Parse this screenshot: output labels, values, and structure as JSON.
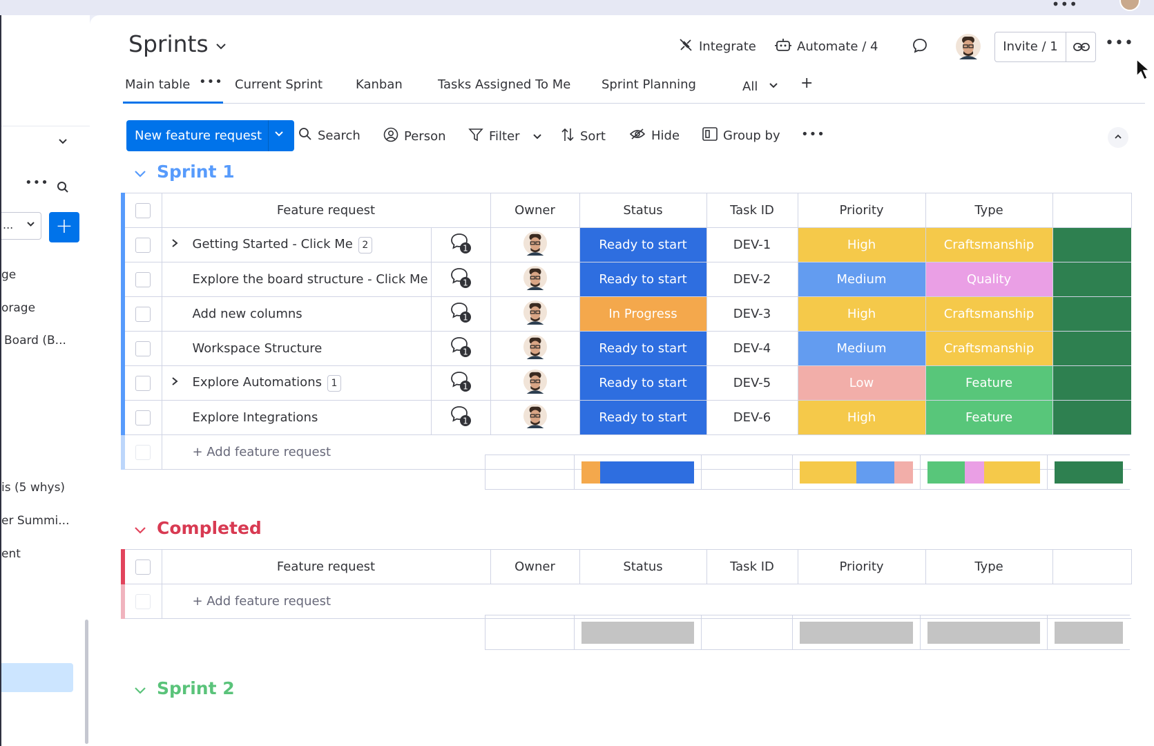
{
  "sidebar": {
    "workspace_label": "...",
    "items": [
      {
        "label": "ge"
      },
      {
        "label": "orage"
      },
      {
        "label": "Board (B..."
      },
      {
        "label": "is (5 whys)"
      },
      {
        "label": "er Summi..."
      },
      {
        "label": "ent"
      }
    ]
  },
  "header": {
    "title": "Sprints",
    "integrate": "Integrate",
    "automate": "Automate / 4",
    "invite": "Invite / 1"
  },
  "tabs": [
    {
      "label": "Main table"
    },
    {
      "label": "Current Sprint"
    },
    {
      "label": "Kanban"
    },
    {
      "label": "Tasks Assigned To Me"
    },
    {
      "label": "Sprint Planning"
    }
  ],
  "tabs_extra": {
    "all": "All"
  },
  "toolbar": {
    "new_item": "New feature request",
    "search": "Search",
    "person": "Person",
    "filter": "Filter",
    "sort": "Sort",
    "hide": "Hide",
    "group_by": "Group by"
  },
  "columns": {
    "name": "Feature request",
    "owner": "Owner",
    "status": "Status",
    "task_id": "Task ID",
    "priority": "Priority",
    "type": "Type"
  },
  "colors": {
    "primary": "#0073ea",
    "ready": "#2e6ee0",
    "in_progress": "#f4a84c",
    "high": "#f5c94a",
    "medium": "#639cf0",
    "low": "#f2aea9",
    "craftsmanship": "#f5c94a",
    "quality": "#ea9fe5",
    "feature": "#58c67a",
    "dark_green": "#2e8050",
    "sprint1": "#579bfc",
    "completed": "#e2445c",
    "sprint2": "#5ac37a",
    "empty_bar": "#c4c4c4"
  },
  "groups": [
    {
      "title": "Sprint 1",
      "add_label": "+ Add feature request",
      "rows": [
        {
          "name": "Getting Started - Click Me",
          "subitems": "2",
          "updates": "1",
          "status": "Ready to start",
          "task_id": "DEV-1",
          "priority": "High",
          "type": "Craftsmanship"
        },
        {
          "name": "Explore the board structure - Click Me",
          "updates": "1",
          "status": "Ready to start",
          "task_id": "DEV-2",
          "priority": "Medium",
          "type": "Quality"
        },
        {
          "name": "Add new columns",
          "updates": "1",
          "status": "In Progress",
          "task_id": "DEV-3",
          "priority": "High",
          "type": "Craftsmanship"
        },
        {
          "name": "Workspace Structure",
          "updates": "1",
          "status": "Ready to start",
          "task_id": "DEV-4",
          "priority": "Medium",
          "type": "Craftsmanship"
        },
        {
          "name": "Explore Automations",
          "subitems": "1",
          "updates": "1",
          "status": "Ready to start",
          "task_id": "DEV-5",
          "priority": "Low",
          "type": "Feature"
        },
        {
          "name": "Explore Integrations",
          "updates": "1",
          "status": "Ready to start",
          "task_id": "DEV-6",
          "priority": "High",
          "type": "Feature"
        }
      ],
      "summary": {
        "status": [
          {
            "label": "In Progress",
            "share": 1
          },
          {
            "label": "Ready to start",
            "share": 5
          }
        ],
        "priority": [
          {
            "label": "High",
            "share": 3
          },
          {
            "label": "Medium",
            "share": 2
          },
          {
            "label": "Low",
            "share": 1
          }
        ],
        "type": [
          {
            "label": "Feature",
            "share": 2
          },
          {
            "label": "Quality",
            "share": 1
          },
          {
            "label": "Craftsmanship",
            "share": 3
          }
        ]
      }
    },
    {
      "title": "Completed",
      "add_label": "+ Add feature request"
    },
    {
      "title": "Sprint 2"
    }
  ]
}
